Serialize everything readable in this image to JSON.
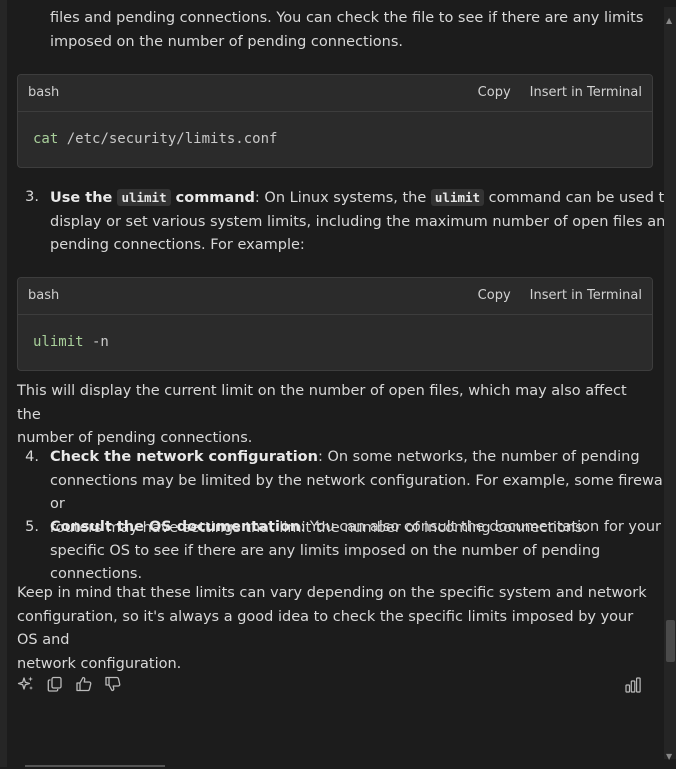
{
  "intro_tail": {
    "line1": "files and pending connections. You can check the file to see if there are any limits",
    "line2": "imposed on the number of pending connections."
  },
  "code_blocks": [
    {
      "lang": "bash",
      "copy": "Copy",
      "insert": "Insert in Terminal",
      "cmd": "cat",
      "args": " /etc/security/limits.conf"
    },
    {
      "lang": "bash",
      "copy": "Copy",
      "insert": "Insert in Terminal",
      "cmd": "ulimit",
      "args": " -n"
    }
  ],
  "item3": {
    "num": "3.",
    "bold1": "Use the ",
    "code1": "ulimit",
    "bold2": " command",
    "text1": ": On Linux systems, the ",
    "code2": "ulimit",
    "text2": " command can be used to",
    "line2": "display or set various system limits, including the maximum number of open files and",
    "line3": "pending connections. For example:"
  },
  "after_code": {
    "line1": "This will display the current limit on the number of open files, which may also affect the",
    "line2": "number of pending connections."
  },
  "item4": {
    "num": "4.",
    "bold": "Check the network configuration",
    "text1": ": On some networks, the number of pending",
    "line2": "connections may be limited by the network configuration. For example, some firewalls or",
    "line3": "routers may have settings that limit the number of incoming connections."
  },
  "item5": {
    "num": "5.",
    "bold": "Consult the OS documentation",
    "text1": ": You can also consult the documentation for your",
    "line2": "specific OS to see if there are any limits imposed on the number of pending connections."
  },
  "closing": {
    "line1": "Keep in mind that these limits can vary depending on the specific system and network",
    "line2": "configuration, so it's always a good idea to check the specific limits imposed by your OS and",
    "line3": "network configuration."
  },
  "toolbar_icons": [
    "sparkle-icon",
    "copy-icon",
    "thumbs-up-icon",
    "thumbs-down-icon",
    "stats-icon"
  ],
  "colors": {
    "background": "#1c1c1c",
    "code_bg": "#2b2b2b",
    "keyword": "#a8cf9a"
  }
}
